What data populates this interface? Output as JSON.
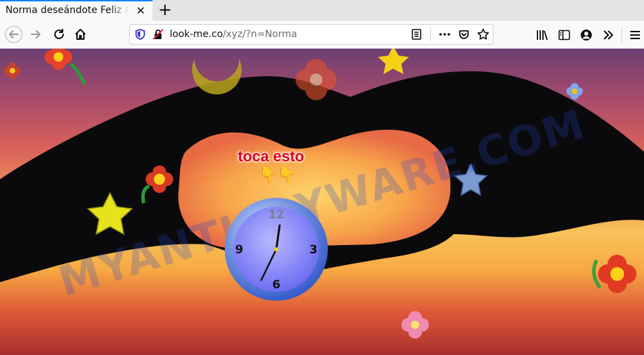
{
  "browser": {
    "tab_title": "Norma deseándote Feliz Año",
    "tab_close_symbol": "✕",
    "new_tab_symbol": "+",
    "url_host": "look-me.co",
    "url_path": "/xyz/?n=Norma"
  },
  "page": {
    "cta_text": "toca esto",
    "pointer_icons": "👇👇",
    "watermark": "MYANTISPYWARE.COM",
    "clock": {
      "n12": "12",
      "n3": "3",
      "n6": "6",
      "n9": "9",
      "hour_hand_deg": 8,
      "minute_hand_deg": 206
    }
  },
  "colors": {
    "accent": "#0a84ff",
    "cta": "#e0001b"
  }
}
